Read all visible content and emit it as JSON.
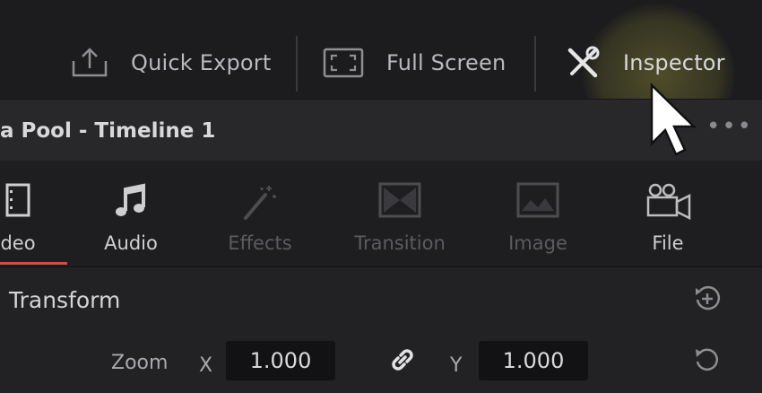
{
  "toolbar": {
    "quick_export_label": "Quick Export",
    "full_screen_label": "Full Screen",
    "inspector_label": "Inspector"
  },
  "panel": {
    "title": "a Pool - Timeline 1",
    "more_label": "•••"
  },
  "tabs": [
    {
      "label": "deo",
      "icon": "video-icon",
      "active": true
    },
    {
      "label": "Audio",
      "icon": "audio-icon",
      "active": true
    },
    {
      "label": "Effects",
      "icon": "effects-wand-icon",
      "active": false
    },
    {
      "label": "Transition",
      "icon": "transition-icon",
      "active": false
    },
    {
      "label": "Image",
      "icon": "image-icon",
      "active": false
    },
    {
      "label": "File",
      "icon": "file-camera-icon",
      "active": true
    }
  ],
  "transform": {
    "section_label": "Transform",
    "zoom_label": "Zoom",
    "x_label": "X",
    "x_value": "1.000",
    "y_label": "Y",
    "y_value": "1.000"
  },
  "colors": {
    "active_tab_underline": "#e04a3c",
    "cursor_highlight": "#7a7832"
  }
}
